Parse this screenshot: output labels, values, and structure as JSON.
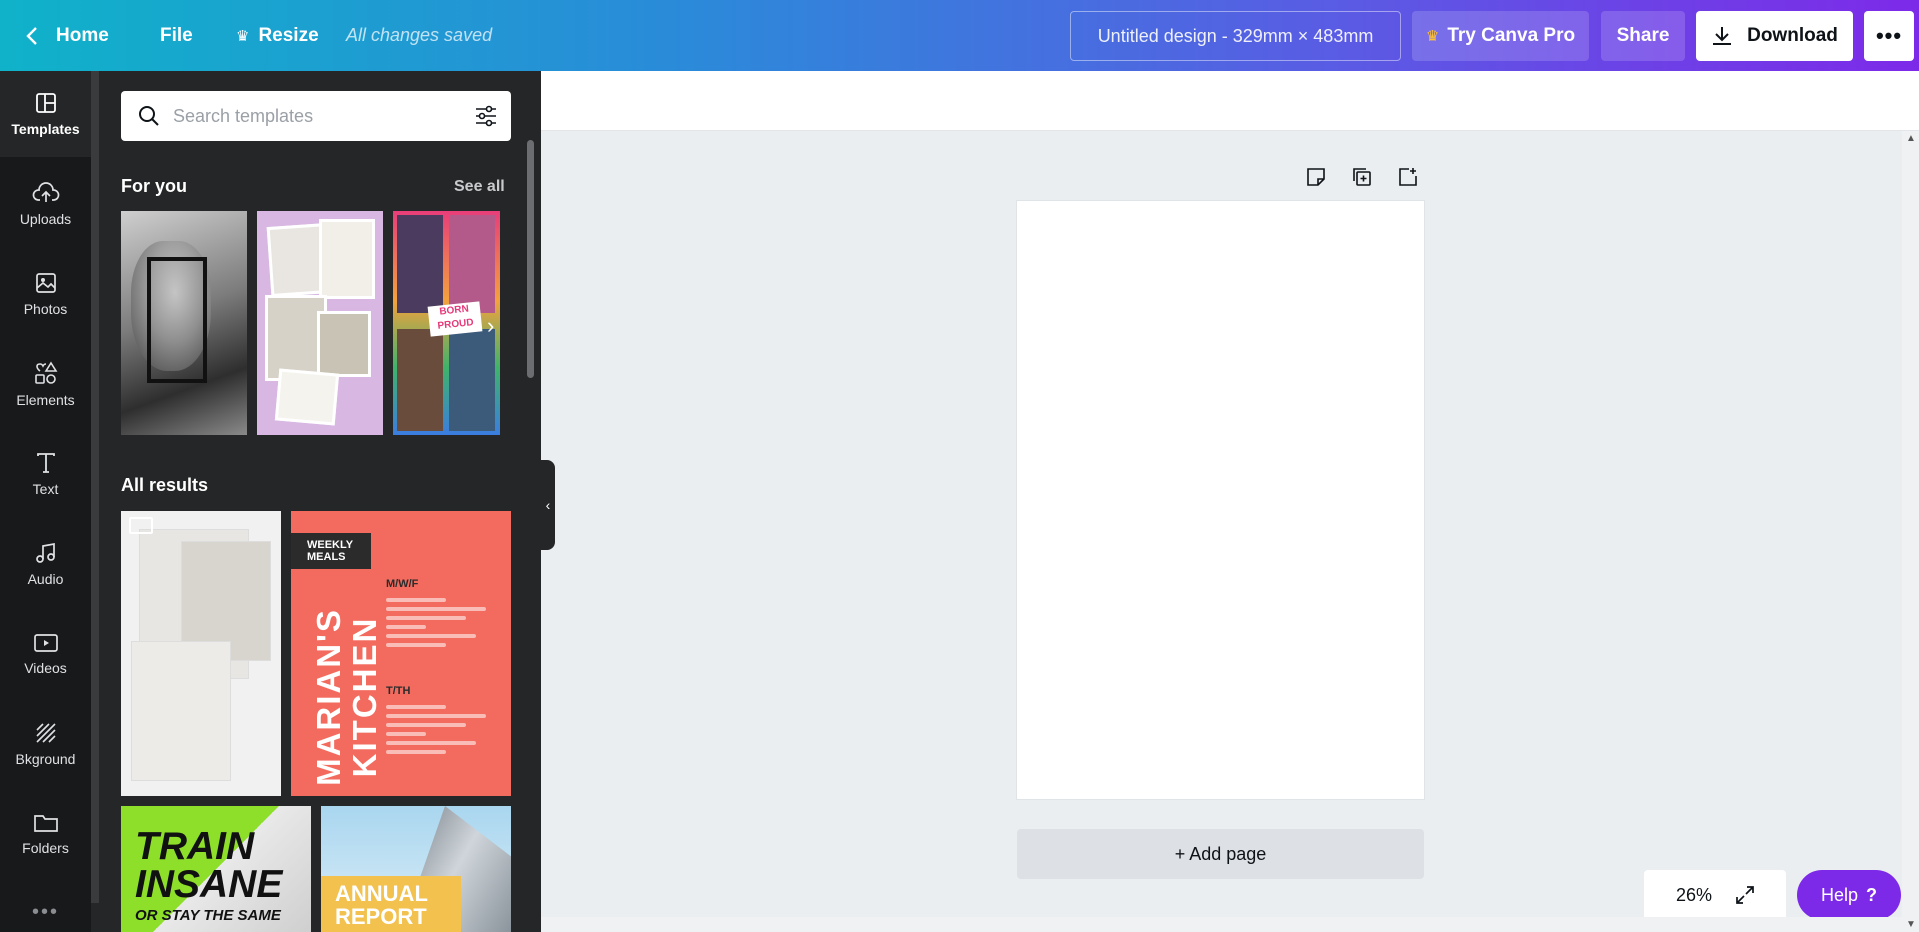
{
  "topbar": {
    "home": "Home",
    "file": "File",
    "resize": "Resize",
    "saved_status": "All changes saved",
    "design_title": "Untitled design - 329mm × 483mm",
    "try_pro": "Try Canva Pro",
    "share": "Share",
    "download": "Download",
    "more": "•••"
  },
  "rail": {
    "items": [
      {
        "label": "Templates",
        "icon": "templates-icon"
      },
      {
        "label": "Uploads",
        "icon": "upload-cloud-icon"
      },
      {
        "label": "Photos",
        "icon": "image-icon"
      },
      {
        "label": "Elements",
        "icon": "shapes-icon"
      },
      {
        "label": "Text",
        "icon": "text-icon"
      },
      {
        "label": "Audio",
        "icon": "music-note-icon"
      },
      {
        "label": "Videos",
        "icon": "video-icon"
      },
      {
        "label": "Bkground",
        "icon": "background-pattern-icon"
      },
      {
        "label": "Folders",
        "icon": "folder-icon"
      }
    ],
    "more": "•••"
  },
  "panel": {
    "search_placeholder": "Search templates",
    "for_you": "For you",
    "see_all": "See all",
    "all_results": "All results",
    "templates": {
      "born_proud": [
        "BORN",
        "PROUD"
      ],
      "weekly_meals": [
        "WEEKLY",
        "MEALS"
      ],
      "kitchen_title": [
        "MARIAN'S",
        "KITCHEN"
      ],
      "menu_days": [
        "M/W/F",
        "T/TH"
      ],
      "train": [
        "TRAIN",
        "INSANE"
      ],
      "train_sub": "OR STAY THE SAME",
      "annual": [
        "ANNUAL",
        "REPORT"
      ]
    }
  },
  "canvas": {
    "add_page": "+ Add page",
    "zoom": "26%",
    "help": "Help",
    "help_icon": "?"
  }
}
